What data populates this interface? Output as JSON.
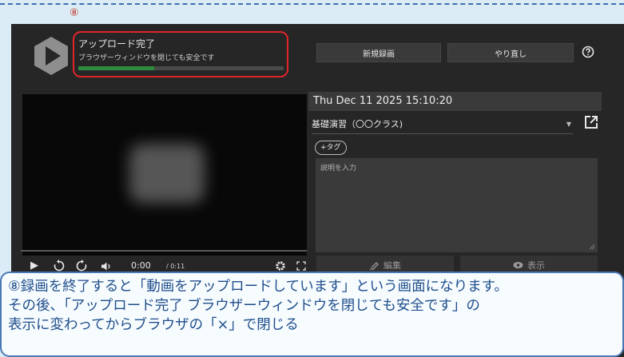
{
  "step_marker": "⑧",
  "upload": {
    "title": "アップロード完了",
    "subtitle": "ブラウザーウィンドウを閉じても安全です",
    "progress_fraction": 0.37
  },
  "toolbar": {
    "new_recording_label": "新規録画",
    "redo_label": "やり直し"
  },
  "player": {
    "current_time": "0:00",
    "total_time": "/ 0:11"
  },
  "details": {
    "datetime": "Thu Dec 11 2025 15:10:20",
    "course": "基礎演習（〇〇クラス)",
    "tag_label": "+タグ",
    "description_placeholder": "説明を入力"
  },
  "actions": {
    "edit_label": "編集",
    "show_label": "表示"
  },
  "caption": {
    "line1": "⑧録画を終了すると「動画をアップロードしています」という画面になります。",
    "line2": "その後、「アップロード完了 ブラウザーウィンドウを閉じても安全です」の",
    "line3": "表示に変わってからブラウザの「×」で閉じる"
  },
  "colors": {
    "highlight_border": "#e0262b",
    "progress": "#2e8b3e",
    "caption_text": "#1f4e8c",
    "caption_border": "#4a78b5"
  }
}
